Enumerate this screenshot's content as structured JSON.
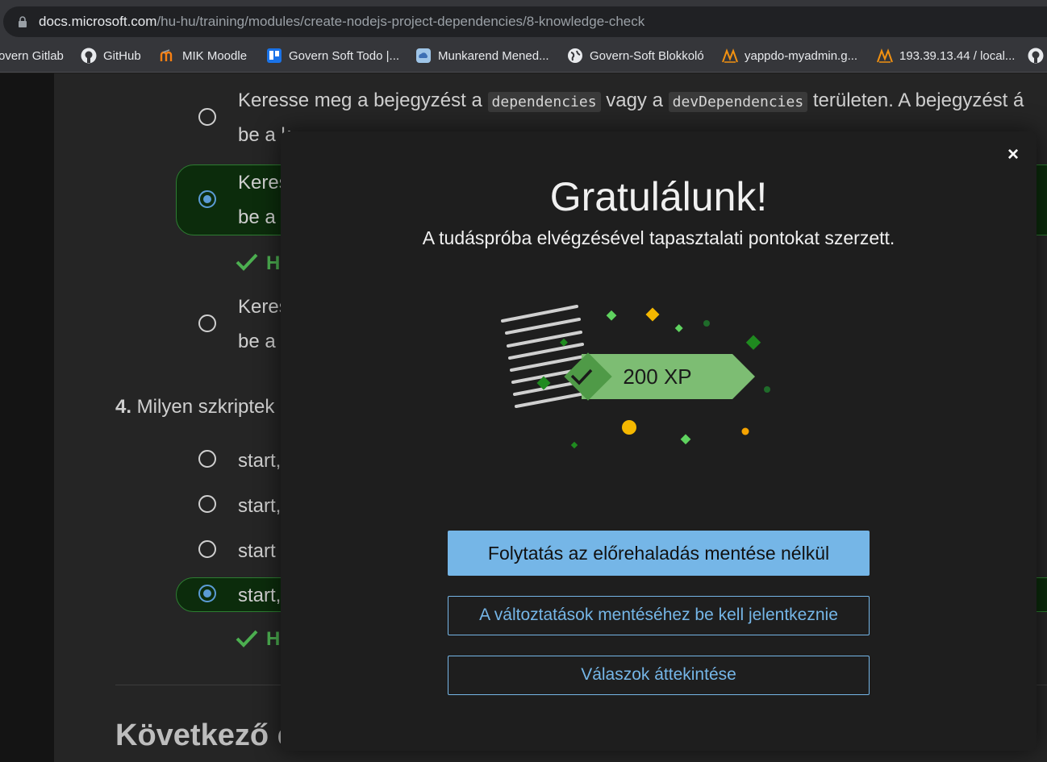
{
  "browser": {
    "url_host": "docs.microsoft.com",
    "url_path": "/hu-hu/training/modules/create-nodejs-project-dependencies/8-knowledge-check",
    "bookmarks": [
      {
        "label": "overn Gitlab",
        "icon": "gitlab-icon"
      },
      {
        "label": "GitHub",
        "icon": "github-icon"
      },
      {
        "label": "MIK Moodle",
        "icon": "moodle-icon"
      },
      {
        "label": "Govern Soft Todo |...",
        "icon": "trello-icon"
      },
      {
        "label": "Munkarend Mened...",
        "icon": "cloud-icon"
      },
      {
        "label": "Govern-Soft Blokkoló",
        "icon": "globe-icon"
      },
      {
        "label": "yappdo-myadmin.g...",
        "icon": "phpmyadmin-icon"
      },
      {
        "label": "193.39.13.44 / local...",
        "icon": "phpmyadmin-icon"
      }
    ]
  },
  "quiz": {
    "q3_options": [
      {
        "pre": "Keresse meg a bejegyzést a ",
        "code1": "dependencies",
        "mid": " vagy a ",
        "code2": "devDependencies",
        "post": " területen. A bejegyzést á",
        "line2": "be a k"
      },
      {
        "line1": "Keres",
        "line2": "be a"
      },
      {
        "line1": "Keres",
        "line2": "be a"
      }
    ],
    "feedback_1": "H",
    "feedback_2": "H",
    "q4_number": "4.",
    "q4_text": " Milyen szkriptek",
    "q4_options": [
      "start,",
      "start,",
      "start",
      "start,"
    ],
    "next_heading": "Következő e"
  },
  "modal": {
    "close_label": "×",
    "title": "Gratulálunk!",
    "subtitle": "A tudáspróba elvégzésével tapasztalati pontokat szerzett.",
    "xp_label": "200 XP",
    "continue_button": "Folytatás az előrehaladás mentése nélkül",
    "signin_button": "A változtatások mentéséhez be kell jelentkeznie",
    "review_button": "Válaszok áttekintése"
  },
  "colors": {
    "accent_blue": "#75b6e7",
    "success_green": "#2e7d32",
    "xp_green": "#7dbd73"
  }
}
